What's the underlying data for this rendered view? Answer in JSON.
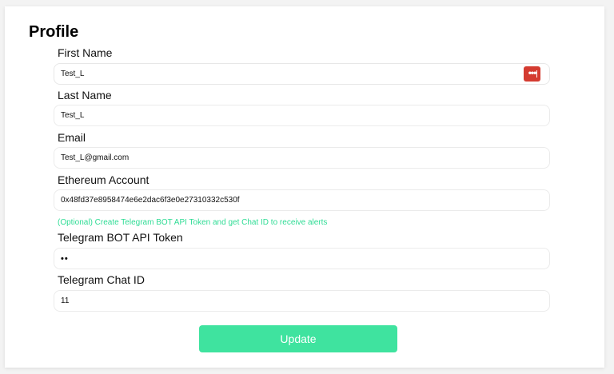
{
  "page": {
    "title": "Profile"
  },
  "form": {
    "first_name": {
      "label": "First Name",
      "value": "Test_L"
    },
    "last_name": {
      "label": "Last Name",
      "value": "Test_L"
    },
    "email": {
      "label": "Email",
      "value": "Test_L@gmail.com"
    },
    "ethereum_account": {
      "label": "Ethereum Account",
      "value": "0x48fd37e8958474e6e2dac6f3e0e27310332c530f"
    },
    "telegram_hint": "(Optional) Create Telegram BOT API Token and get Chat ID to receive alerts",
    "telegram_token": {
      "label": "Telegram BOT API Token",
      "value": "••"
    },
    "telegram_chat_id": {
      "label": "Telegram Chat ID",
      "value": "11"
    },
    "password_manager_icon": "password-manager-icon",
    "update_label": "Update"
  },
  "colors": {
    "accent": "#3fe39f",
    "hint": "#2fdc95",
    "password_manager": "#d43b30"
  }
}
